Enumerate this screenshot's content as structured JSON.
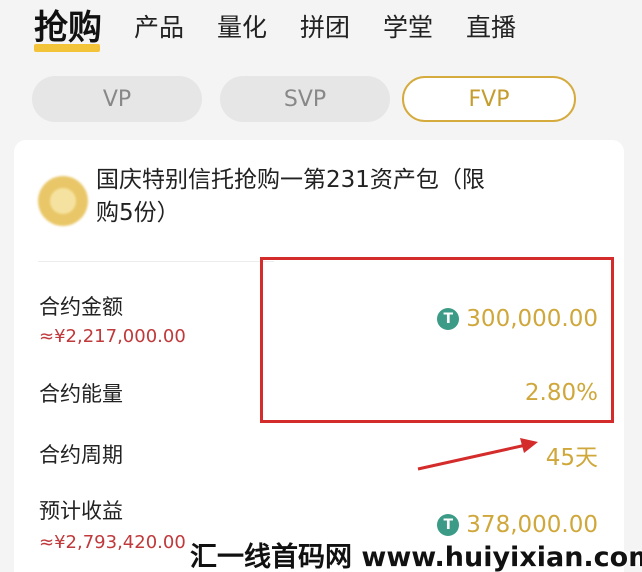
{
  "nav": {
    "tabs": [
      "抢购",
      "产品",
      "量化",
      "拼团",
      "学堂",
      "直播"
    ],
    "active_index": 0
  },
  "segments": {
    "items": [
      "VP",
      "SVP",
      "FVP"
    ],
    "active_index": 2
  },
  "product": {
    "icon": "product-logo-icon",
    "title_line1": "国庆特别信托抢购一第231资产包（限",
    "title_line2": "购5份）"
  },
  "contract": {
    "amount_label": "合约金额",
    "amount_sub": "≈¥2,217,000.00",
    "amount_value": "300,000.00",
    "energy_label": "合约能量",
    "energy_value": "2.80%",
    "period_label": "合约周期",
    "period_value": "45天",
    "earnings_label": "预计收益",
    "earnings_sub": "≈¥2,793,420.00",
    "earnings_value": "378,000.00",
    "coin_symbol": "T"
  },
  "watermark": {
    "text": "汇一线首码网 www.huiyixian.com"
  },
  "colors": {
    "accent_gold": "#cfa73b",
    "highlight_red": "#d42b2b",
    "underline_yellow": "#f3c43a",
    "sub_text_red": "#c0393b",
    "coin_green": "#3c9b86"
  }
}
